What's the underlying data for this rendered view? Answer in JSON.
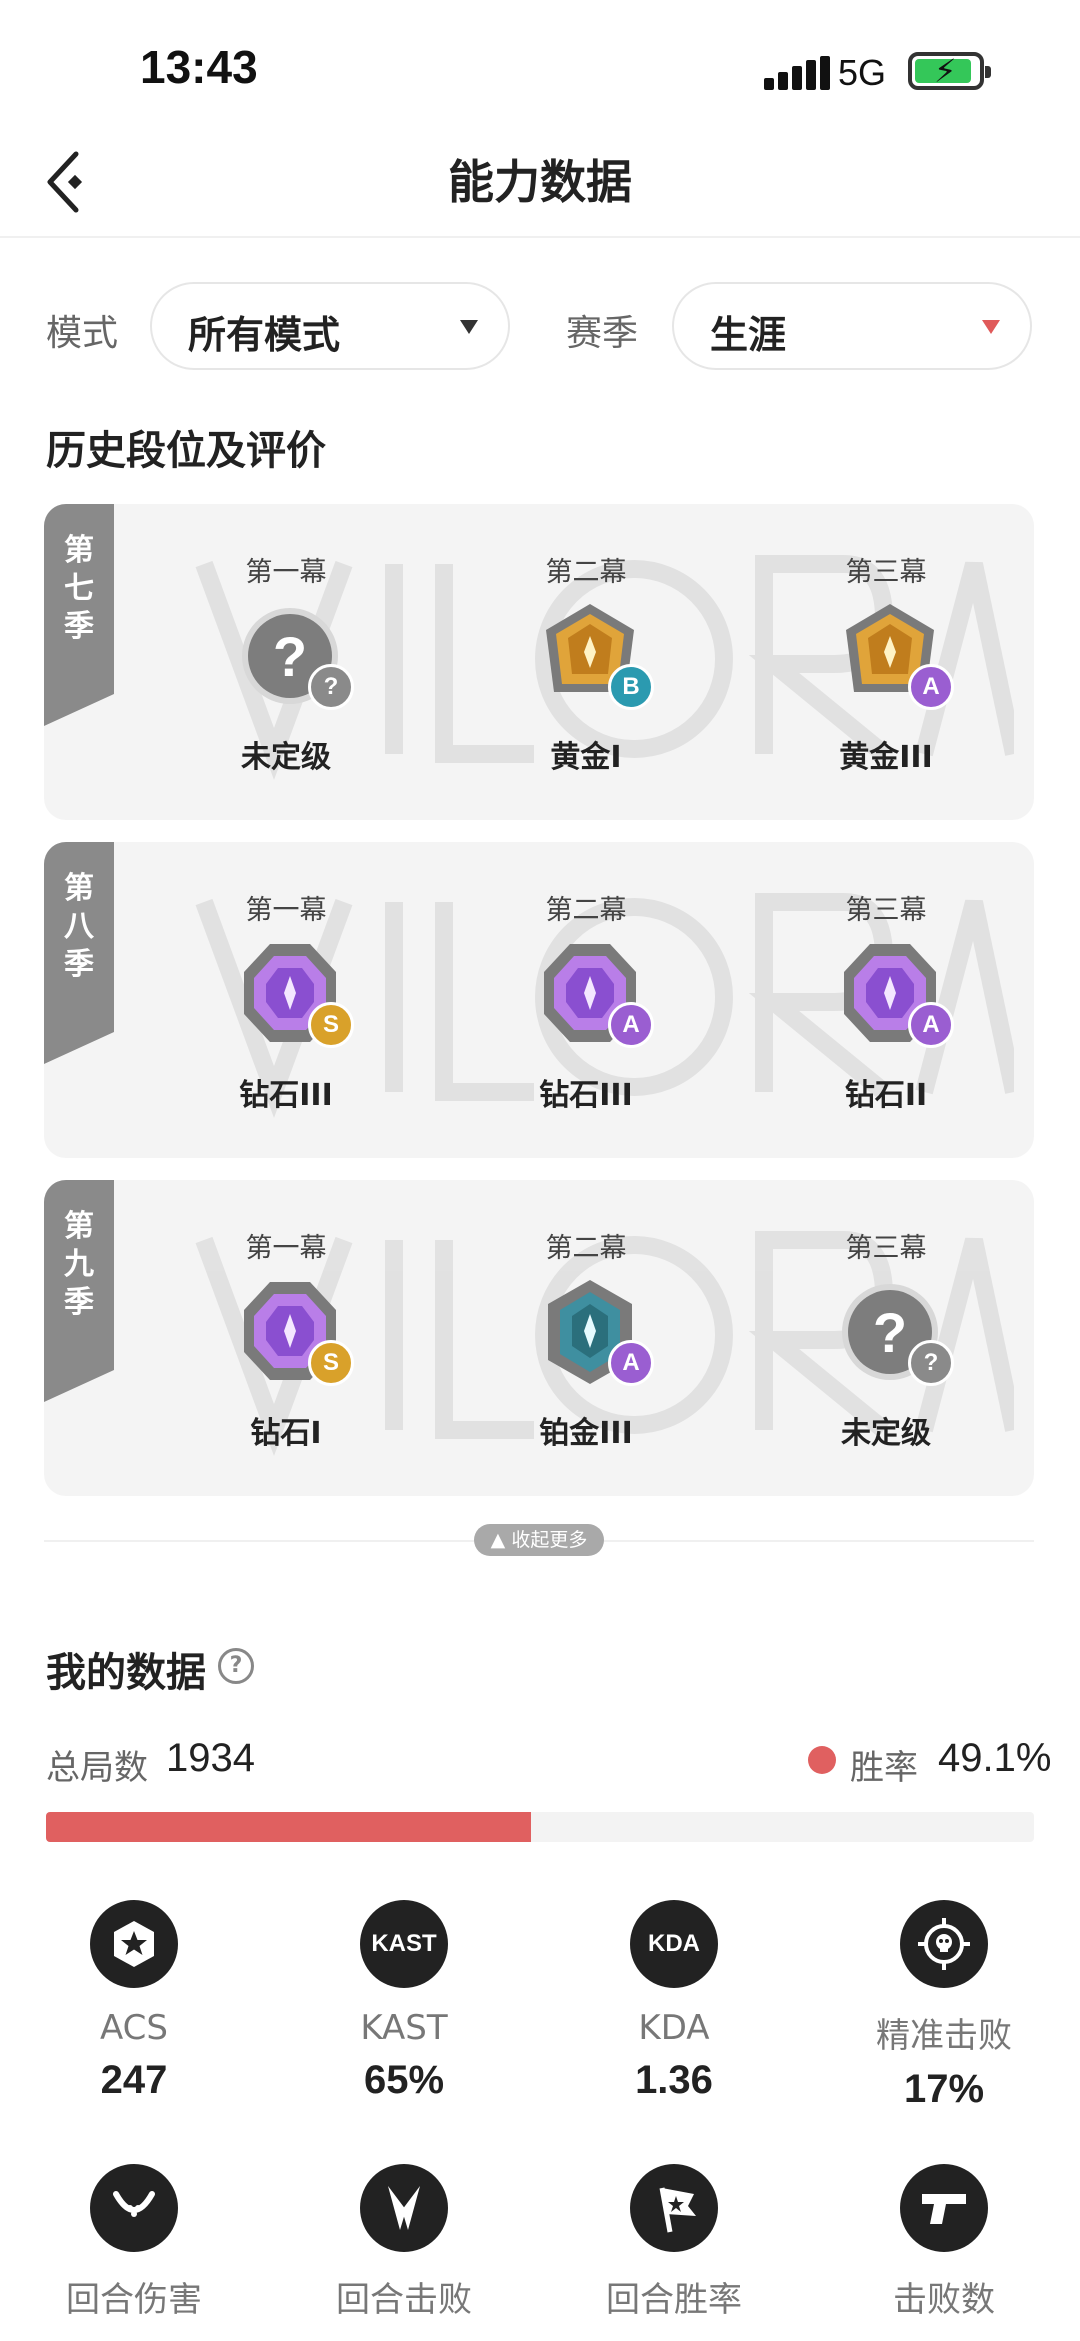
{
  "status_bar": {
    "time": "13:43",
    "network": "5G"
  },
  "nav": {
    "title": "能力数据"
  },
  "filters": {
    "mode_label": "模式",
    "mode_value": "所有模式",
    "season_label": "赛季",
    "season_value": "生涯"
  },
  "history": {
    "title": "历史段位及评价",
    "seasons": [
      {
        "tag": "第七季",
        "acts": [
          {
            "label": "第一幕",
            "rank": "未定级",
            "grade": "?",
            "icon": "unranked-icon"
          },
          {
            "label": "第二幕",
            "rank": "黄金I",
            "grade": "B",
            "icon": "gold-rank-icon"
          },
          {
            "label": "第三幕",
            "rank": "黄金III",
            "grade": "A",
            "icon": "gold-rank-icon"
          }
        ]
      },
      {
        "tag": "第八季",
        "acts": [
          {
            "label": "第一幕",
            "rank": "钻石III",
            "grade": "S",
            "icon": "diamond-rank-icon"
          },
          {
            "label": "第二幕",
            "rank": "钻石III",
            "grade": "A",
            "icon": "diamond-rank-icon"
          },
          {
            "label": "第三幕",
            "rank": "钻石II",
            "grade": "A",
            "icon": "diamond-rank-icon"
          }
        ]
      },
      {
        "tag": "第九季",
        "acts": [
          {
            "label": "第一幕",
            "rank": "钻石I",
            "grade": "S",
            "icon": "diamond-rank-icon"
          },
          {
            "label": "第二幕",
            "rank": "铂金III",
            "grade": "A",
            "icon": "platinum-rank-icon"
          },
          {
            "label": "第三幕",
            "rank": "未定级",
            "grade": "?",
            "icon": "unranked-icon"
          }
        ]
      }
    ],
    "collapse_label": "收起更多"
  },
  "my_data": {
    "title": "我的数据",
    "total_label": "总局数",
    "total_value": "1934",
    "win_label": "胜率",
    "win_value": "49.1%",
    "win_rate": 0.491,
    "stats": [
      {
        "icon": "star-hex-icon",
        "label": "ACS",
        "value": "247"
      },
      {
        "icon": "kast-icon",
        "icon_text": "KAST",
        "label": "KAST",
        "value": "65%"
      },
      {
        "icon": "kda-icon",
        "icon_text": "KDA",
        "label": "KDA",
        "value": "1.36"
      },
      {
        "icon": "crosshair-skull-icon",
        "label": "精准击败",
        "value": "17%"
      },
      {
        "icon": "damage-icon",
        "label": "回合伤害",
        "value": ""
      },
      {
        "icon": "crossed-blades-icon",
        "label": "回合击败",
        "value": ""
      },
      {
        "icon": "flag-icon",
        "label": "回合胜率",
        "value": ""
      },
      {
        "icon": "pistol-icon",
        "label": "击败数",
        "value": ""
      }
    ]
  },
  "colors": {
    "accent_red": "#e06060",
    "grade_s": "#d9a12a",
    "grade_a": "#9a5ed1",
    "grade_b": "#2b9ab0",
    "grade_unranked": "#8a8a8a"
  }
}
